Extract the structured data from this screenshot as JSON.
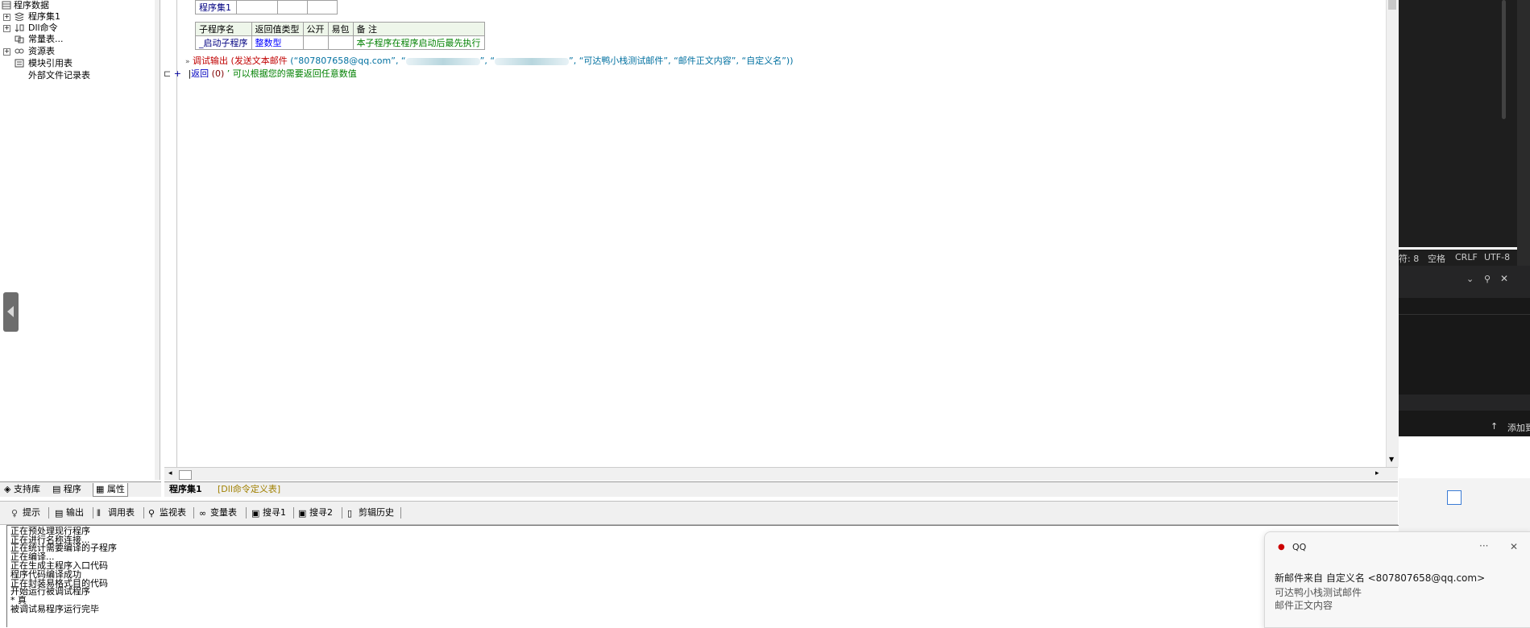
{
  "tree": {
    "root": "程序数据",
    "items": [
      "程序集1",
      "Dll命令",
      "常量表...",
      "资源表",
      "模块引用表",
      "外部文件记录表"
    ]
  },
  "left_tabs": [
    "支持库",
    "程序",
    "属性"
  ],
  "editor": {
    "assembly_table": {
      "name": "程序集1"
    },
    "sub_table": {
      "headers": [
        "子程序名",
        "返回值类型",
        "公开",
        "易包",
        "备 注"
      ],
      "row": {
        "name": "_启动子程序",
        "type": "整数型",
        "public": "",
        "easy": "",
        "note": "本子程序在程序启动后最先执行"
      }
    },
    "line1": {
      "fn": "调试输出",
      "open": " (",
      "call": "发送文本邮件",
      "args_start": " (“807807658@qq.com”, “",
      "args_mid": "”, “",
      "args_end": "”, “可达鸭小栈测试邮件”, “邮件正文内容”, “自定义名”))"
    },
    "line2": {
      "kw": "返回",
      "val": " (0) ",
      "comment": "’ 可以根据您的需要返回任意数值"
    }
  },
  "editor_tabs": [
    "程序集1",
    "[Dll命令定义表]"
  ],
  "bottom_tabs": [
    "提示",
    "输出",
    "调用表",
    "监视表",
    "变量表",
    "搜寻1",
    "搜寻2",
    "剪辑历史"
  ],
  "output_lines": [
    "正在预处理现行程序",
    "正在进行名称连接...",
    "正在统计需要编译的子程序",
    "正在编译...",
    "正在生成主程序入口代码",
    "程序代码编译成功",
    "正在封装易格式目的代码",
    "开始运行被调试程序",
    "* 真",
    "被调试易程序运行完毕"
  ],
  "status_bar": {
    "chars": "符: 8",
    "spaces": "空格",
    "eol": "CRLF",
    "encoding": "UTF-8"
  },
  "dark_bottom": {
    "add": "添加到"
  },
  "toast": {
    "app": "QQ",
    "title": "新邮件来自 自定义名 <807807658@qq.com>",
    "subject": "可达鸭小栈测试邮件",
    "body": "邮件正文内容",
    "more": "···",
    "close": "✕"
  },
  "colors": {
    "red": "#c00000",
    "blue": "#0000ff",
    "green": "#008000",
    "string": "#0070a0"
  }
}
